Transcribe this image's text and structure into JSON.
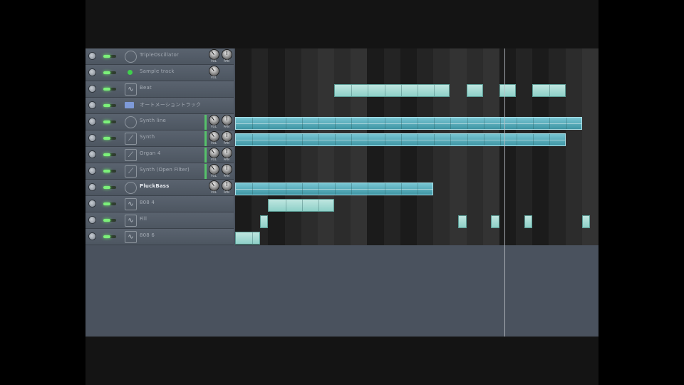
{
  "tracks": [
    {
      "name": "TripleOscillator",
      "icon": "round-icon",
      "clips": [],
      "knobs": true
    },
    {
      "name": "Sample track",
      "icon": "green-dot-icon",
      "clips": [],
      "knobs": "vol"
    },
    {
      "name": "Beat",
      "icon": "wave-icon",
      "clips": [
        [
          6,
          13
        ],
        [
          14,
          15
        ],
        [
          16,
          17
        ],
        [
          18,
          20
        ]
      ],
      "knobs": false
    },
    {
      "name": "オートメーショントラック",
      "icon": "folder-icon",
      "clips": [],
      "knobs": false
    },
    {
      "name": "Synth line",
      "icon": "round-icon",
      "clips": [
        [
          0,
          21
        ]
      ],
      "wave": true,
      "green": true,
      "knobs": true
    },
    {
      "name": "Synth",
      "icon": "slider-icon",
      "clips": [
        [
          0,
          20
        ]
      ],
      "wave": true,
      "green": true,
      "knobs": true
    },
    {
      "name": "Organ 4",
      "icon": "slider-icon",
      "clips": [],
      "green": true,
      "knobs": true
    },
    {
      "name": "Synth (Open Filter)",
      "icon": "slider-icon",
      "clips": [],
      "green": true,
      "knobs": true
    },
    {
      "name": "PluckBass",
      "icon": "round-icon",
      "clips": [
        [
          0,
          12
        ]
      ],
      "wave": true,
      "active": true,
      "knobs": true
    },
    {
      "name": "808 4",
      "icon": "wave-icon",
      "clips": [
        [
          2,
          6
        ]
      ],
      "knobs": false
    },
    {
      "name": "Fill",
      "icon": "wave-icon",
      "clips": [
        [
          1.5,
          2
        ],
        [
          13.5,
          14
        ],
        [
          15.5,
          16
        ],
        [
          17.5,
          18
        ],
        [
          21,
          21.5
        ]
      ],
      "knobs": false
    },
    {
      "name": "808 6",
      "icon": "wave-icon",
      "clips": [
        [
          0,
          1.5
        ]
      ],
      "knobs": false
    }
  ],
  "knob_labels": {
    "vol": "VOL",
    "pan": "PAN"
  },
  "timeline": {
    "bars": 22,
    "playhead_bar": 16.3
  }
}
